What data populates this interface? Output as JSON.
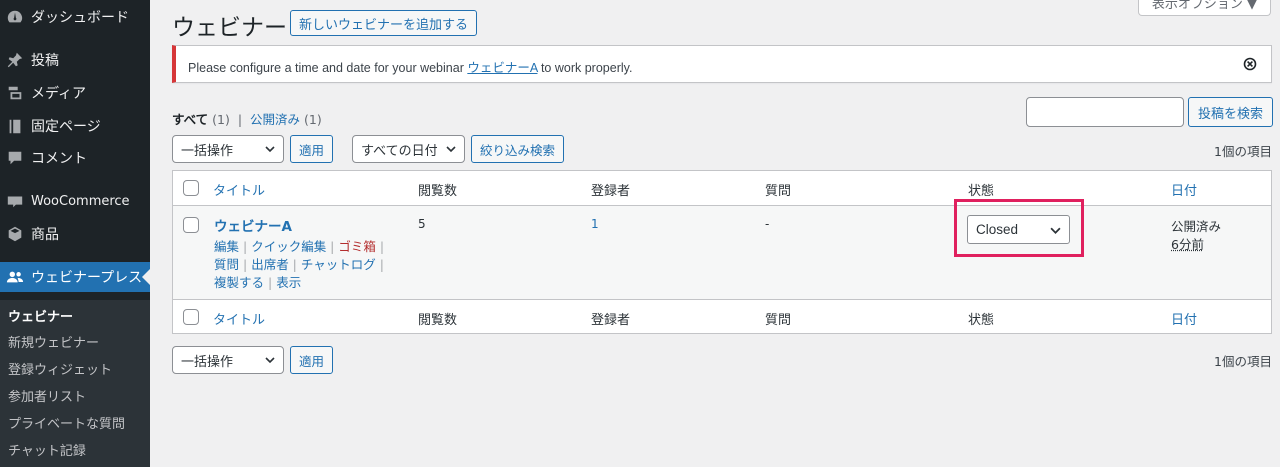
{
  "sidebar": {
    "items": [
      {
        "label": "ダッシュボード",
        "icon": "dashboard-icon"
      },
      {
        "label": "投稿",
        "icon": "pin-icon"
      },
      {
        "label": "メディア",
        "icon": "media-icon"
      },
      {
        "label": "固定ページ",
        "icon": "page-icon"
      },
      {
        "label": "コメント",
        "icon": "comment-icon"
      },
      {
        "label": "WooCommerce",
        "icon": "woocommerce-icon"
      },
      {
        "label": "商品",
        "icon": "box-icon"
      },
      {
        "label": "ウェビナープレス",
        "icon": "users-icon"
      }
    ],
    "submenu": [
      "ウェビナー",
      "新規ウェビナー",
      "登録ウィジェット",
      "参加者リスト",
      "プライベートな質問",
      "チャット記録"
    ]
  },
  "header": {
    "title": "ウェビナー",
    "add_new_label": "新しいウェビナーを追加する",
    "screen_options_label": "表示オプション ▼"
  },
  "notice": {
    "text_before": "Please configure a time and date for your webinar ",
    "link": "ウェビナーA",
    "text_after": " to work properly."
  },
  "views": {
    "all_label": "すべて",
    "all_count": "(1)",
    "separator": "|",
    "published_label": "公開済み",
    "published_count": "(1)"
  },
  "search": {
    "value": "",
    "button_label": "投稿を検索"
  },
  "tablenav_top": {
    "bulk_action": "一括操作",
    "apply_label": "適用",
    "date_filter": "すべての日付",
    "filter_label": "絞り込み検索",
    "item_count": "1個の項目"
  },
  "tablenav_bottom": {
    "bulk_action": "一括操作",
    "apply_label": "適用",
    "item_count": "1個の項目"
  },
  "table": {
    "columns": [
      "タイトル",
      "閲覧数",
      "登録者",
      "質問",
      "状態",
      "日付"
    ],
    "rows": [
      {
        "title": "ウェビナーA",
        "views": "5",
        "registrants": "1",
        "questions": "-",
        "status": "Closed",
        "date_status": "公開済み",
        "date_ago": "6分前",
        "actions": [
          "編集",
          "クイック編集",
          "ゴミ箱",
          "質問",
          "出席者",
          "チャットログ",
          "複製する",
          "表示"
        ]
      }
    ]
  },
  "colors": {
    "sidebar_bg": "#1d2327",
    "accent": "#2271b1",
    "highlight": "#e0205e",
    "notice_error": "#d63638"
  }
}
